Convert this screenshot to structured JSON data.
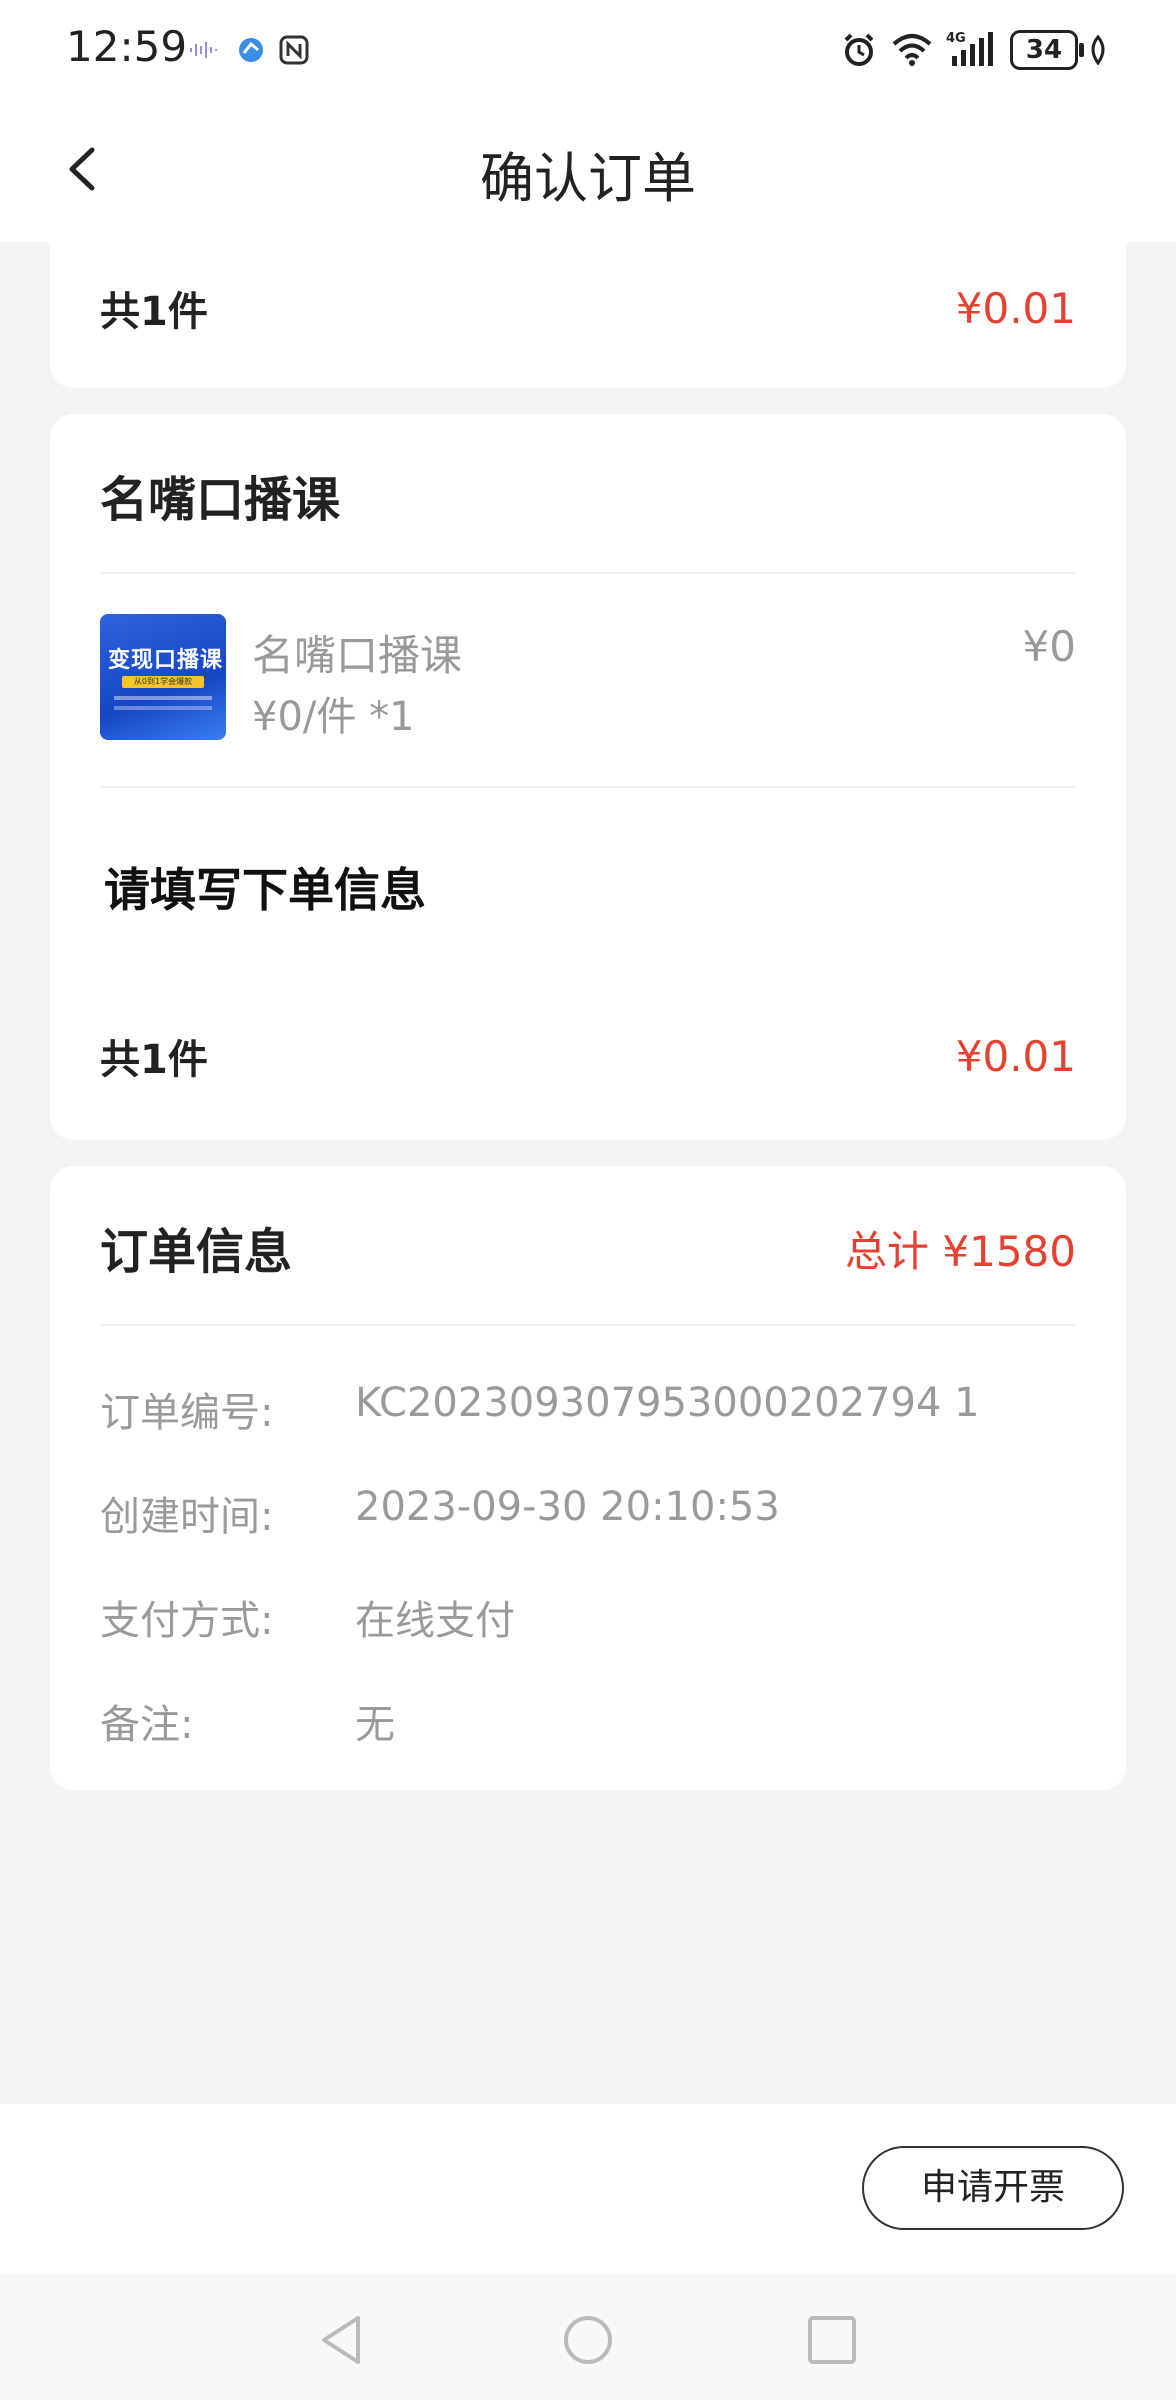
{
  "status_bar": {
    "time": "12:59",
    "battery": "34",
    "network": "4G"
  },
  "nav": {
    "title": "确认订单"
  },
  "summary_top": {
    "count_label": "共1件",
    "amount": "¥0.01"
  },
  "course_card": {
    "section_title": "名嘴口播课",
    "item": {
      "thumbnail_text": "变现口播课",
      "thumbnail_tag": "从0到1学会爆款",
      "name": "名嘴口播课",
      "unit_price": "¥0/件 *1",
      "price": "¥0"
    },
    "fill_info_title": "请填写下单信息",
    "count_label": "共1件",
    "amount": "¥0.01"
  },
  "order_info": {
    "title": "订单信息",
    "total": "总计 ¥1580",
    "rows": [
      {
        "label": "订单编号:",
        "value": "KC202309307953000202794 1"
      },
      {
        "label": "创建时间:",
        "value": "2023-09-30 20:10:53"
      },
      {
        "label": "支付方式:",
        "value": "在线支付"
      },
      {
        "label": "备注:",
        "value": "无"
      }
    ]
  },
  "bottom": {
    "invoice_button": "申请开票"
  },
  "colors": {
    "accent_red": "#e64031",
    "background": "#f4f4f4"
  }
}
